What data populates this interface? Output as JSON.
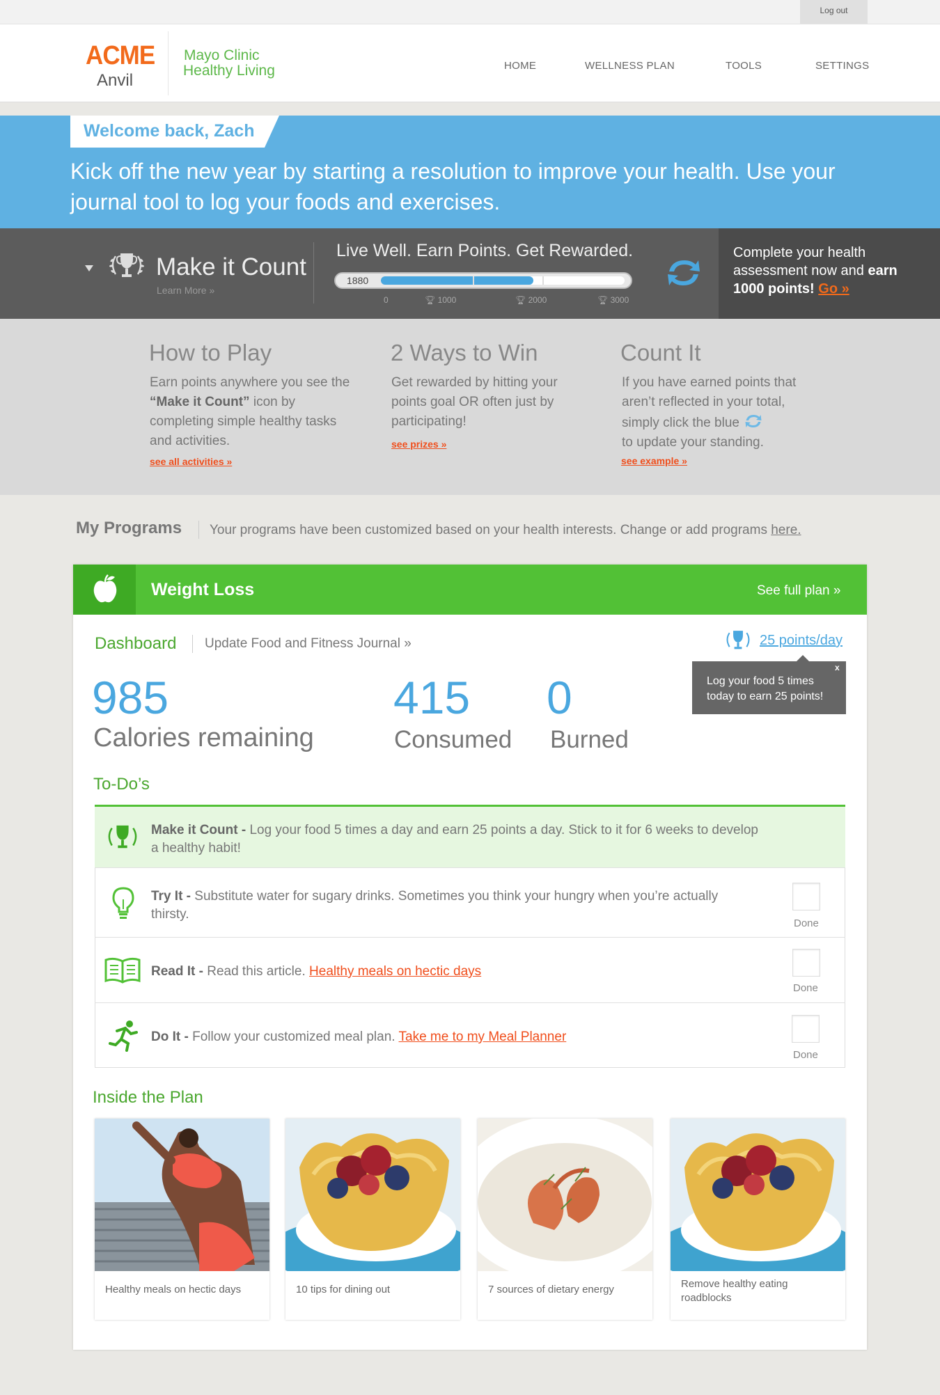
{
  "topbar": {
    "logout_label": "Log out"
  },
  "header": {
    "brand": "ACME",
    "brand_sub": "Anvil",
    "partner_line1": "Mayo Clinic",
    "partner_line2": "Healthy Living",
    "nav": [
      "HOME",
      "WELLNESS PLAN",
      "TOOLS",
      "SETTINGS"
    ]
  },
  "banner": {
    "welcome": "Welcome back, Zach",
    "message": "Kick off the new year by starting a resolution to improve your health. Use your journal tool to log your foods and exercises."
  },
  "rewards": {
    "title": "Make it Count",
    "learn_more": "Learn More »",
    "tagline": "Live Well. Earn Points. Get Rewarded.",
    "points": "1880",
    "progress_fraction": 0.627,
    "ticks": [
      "0",
      "1000",
      "2000",
      "3000"
    ],
    "assessment_text": "Complete your health assessment now and",
    "assessment_bold": "earn 1000 points!",
    "go_label": "Go »",
    "colors": {
      "accent": "#4aa7df",
      "orange": "#f26a1b"
    }
  },
  "info": {
    "how": {
      "title": "How to Play",
      "text_a": "Earn points anywhere you see the ",
      "text_bold": "“Make it Count”",
      "text_b": " icon by completing simple healthy tasks and activities.",
      "link": "see all activities »"
    },
    "ways": {
      "title": "2 Ways to Win",
      "text": "Get rewarded by hitting your points goal OR often just by participating!",
      "link": "see prizes »"
    },
    "count": {
      "title": "Count It",
      "text_a": "If you have earned points that aren’t reflected in your total, simply click the blue",
      "text_b": "to update your standing.",
      "link": "see example »"
    }
  },
  "programs": {
    "title": "My Programs",
    "desc": "Your programs have been customized based on your health interests. Change or add programs ",
    "here_link": "here."
  },
  "weight_loss": {
    "title": "Weight Loss",
    "see_full": "See full plan »",
    "dashboard_tab": "Dashboard",
    "update_tab": "Update Food and Fitness Journal »",
    "points_per_day": "25 points/day",
    "tooltip": "Log your food 5 times today to earn 25 points!",
    "tooltip_close": "x",
    "calories_remaining": "985",
    "calories_remaining_label": "Calories remaining",
    "consumed": "415",
    "consumed_label": "Consumed",
    "burned": "0",
    "burned_label": "Burned",
    "todo_title": "To-Do’s",
    "todos": [
      {
        "title": "Make it Count -",
        "text": " Log your food 5 times a day and earn 25 points a day. Stick to it for 6 weeks to develop a healthy habit!"
      },
      {
        "title": "Try It -",
        "text": " Substitute water for sugary drinks. Sometimes you think your hungry when you’re actually thirsty.",
        "done": "Done"
      },
      {
        "title": "Read It -",
        "text": " Read this article. ",
        "link": "Healthy meals on hectic days",
        "done": "Done"
      },
      {
        "title": "Do It -",
        "text": " Follow your customized meal plan. ",
        "link": "Take me to my Meal Planner",
        "done": "Done"
      }
    ],
    "inside_title": "Inside the Plan",
    "articles": [
      {
        "caption": "Healthy meals on hectic days"
      },
      {
        "caption": "10 tips for dining out"
      },
      {
        "caption": "7 sources of dietary energy"
      },
      {
        "caption": "Remove healthy eating roadblocks"
      }
    ]
  }
}
